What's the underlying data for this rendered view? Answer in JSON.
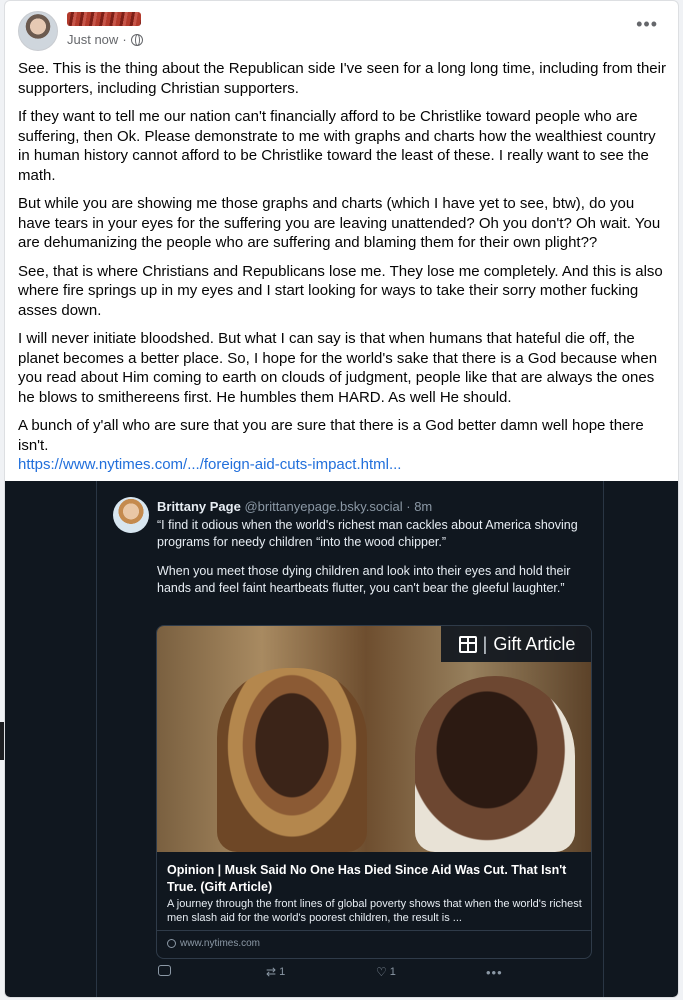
{
  "post": {
    "timestamp": "Just now",
    "paragraphs": [
      "See. This is the thing about the Republican side I've seen for a long long time, including from their supporters, including Christian supporters.",
      "If they want to tell me our nation can't financially afford to be Christlike toward people who are suffering, then Ok. Please demonstrate to me with graphs and charts how the wealthiest country in human history cannot afford to be Christlike toward the least of these. I really want to see the math.",
      "But while you are showing me those graphs and charts (which I have yet to see, btw), do you have tears in your eyes for the suffering you are leaving unattended? Oh you don't? Oh wait. You are dehumanizing the people who are suffering and blaming them for their own plight??",
      "See, that is where Christians and Republicans lose me. They lose me completely. And this is also where fire springs up in my eyes and I start looking for ways to take their sorry mother fucking asses down.",
      "I will never initiate bloodshed. But what I can say is that when humans that hateful die off, the planet becomes a better place. So, I hope for the world's sake that there is a God because when you read about Him coming to earth on clouds of judgment, people like that are always the ones he blows to smithereens first. He humbles them HARD. As well He should.",
      "A bunch of y'all who are sure that you are sure that there is a God better damn well hope there isn't."
    ],
    "link": "https://www.nytimes.com/.../foreign-aid-cuts-impact.html..."
  },
  "embed": {
    "author_name": "Brittany Page",
    "author_handle": "@brittanyepage.bsky.social",
    "age": "· 8m",
    "text": [
      "“I find it odious when the world's richest man cackles about America shoving programs for needy children “into the wood chipper.”",
      "When you meet those dying children and look into their eyes and hold their hands and feel faint heartbeats flutter, you can't bear the gleeful laughter.”"
    ],
    "gift_label": "Gift Article",
    "gift_separator": "|",
    "article_title": "Opinion | Musk Said No One Has Died Since Aid Was Cut. That Isn't True. (Gift Article)",
    "article_desc": "A journey through the front lines of global poverty shows that when the world's richest men slash aid for the world's poorest children, the result is ...",
    "article_domain": "www.nytimes.com",
    "reposts": "1",
    "likes": "1"
  },
  "icons": {
    "post_more": "more-horizontal-icon",
    "privacy": "globe-icon",
    "gift": "gift-icon",
    "reply": "reply-icon",
    "repost": "repost-icon",
    "like": "heart-icon"
  },
  "colors": {
    "link": "#216fdb",
    "embed_background": "#10171f",
    "muted": "#65676b"
  }
}
